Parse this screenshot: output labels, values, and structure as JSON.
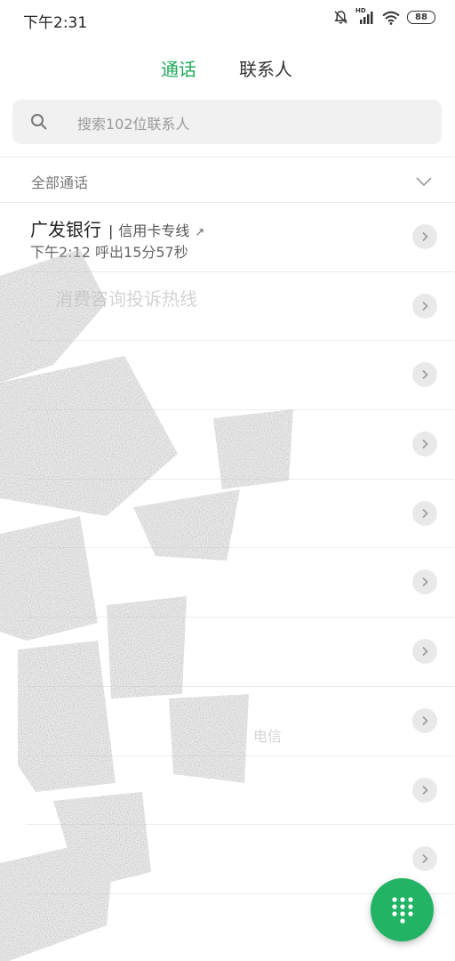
{
  "status_bar": {
    "time": "下午2:31",
    "hd_label": "HD",
    "battery": "88"
  },
  "tabs": [
    {
      "label": "通话",
      "active": true
    },
    {
      "label": "联系人",
      "active": false
    }
  ],
  "search": {
    "placeholder": "搜索102位联系人"
  },
  "filter": {
    "label": "全部通话"
  },
  "calls": [
    {
      "name": "广发银行",
      "separator": "|",
      "tag": "信用卡专线",
      "detail": "下午2:12 呼出15分57秒"
    },
    {
      "name": "消费咨询投诉热线",
      "separator": "",
      "tag": "",
      "detail": ""
    },
    {
      "name": "",
      "separator": "",
      "tag": "",
      "detail": ""
    },
    {
      "name": "",
      "separator": "",
      "tag": "",
      "detail": ""
    },
    {
      "name": "",
      "separator": "",
      "tag": "",
      "detail": ""
    },
    {
      "name": "",
      "separator": "",
      "tag": "",
      "detail": ""
    },
    {
      "name": "",
      "separator": "",
      "tag": "",
      "detail": ""
    },
    {
      "name": "",
      "separator": "",
      "tag": "",
      "detail": "电信"
    },
    {
      "name": "",
      "separator": "",
      "tag": "",
      "detail": ""
    },
    {
      "name": "",
      "separator": "",
      "tag": "",
      "detail": ""
    }
  ],
  "colors": {
    "accent": "#1eaa5a",
    "fab": "#22b464"
  },
  "icons": {
    "search": "search-icon",
    "chevron": "chevron-down-icon",
    "detail": "chevron-right-icon",
    "dialpad": "dialpad-icon"
  }
}
